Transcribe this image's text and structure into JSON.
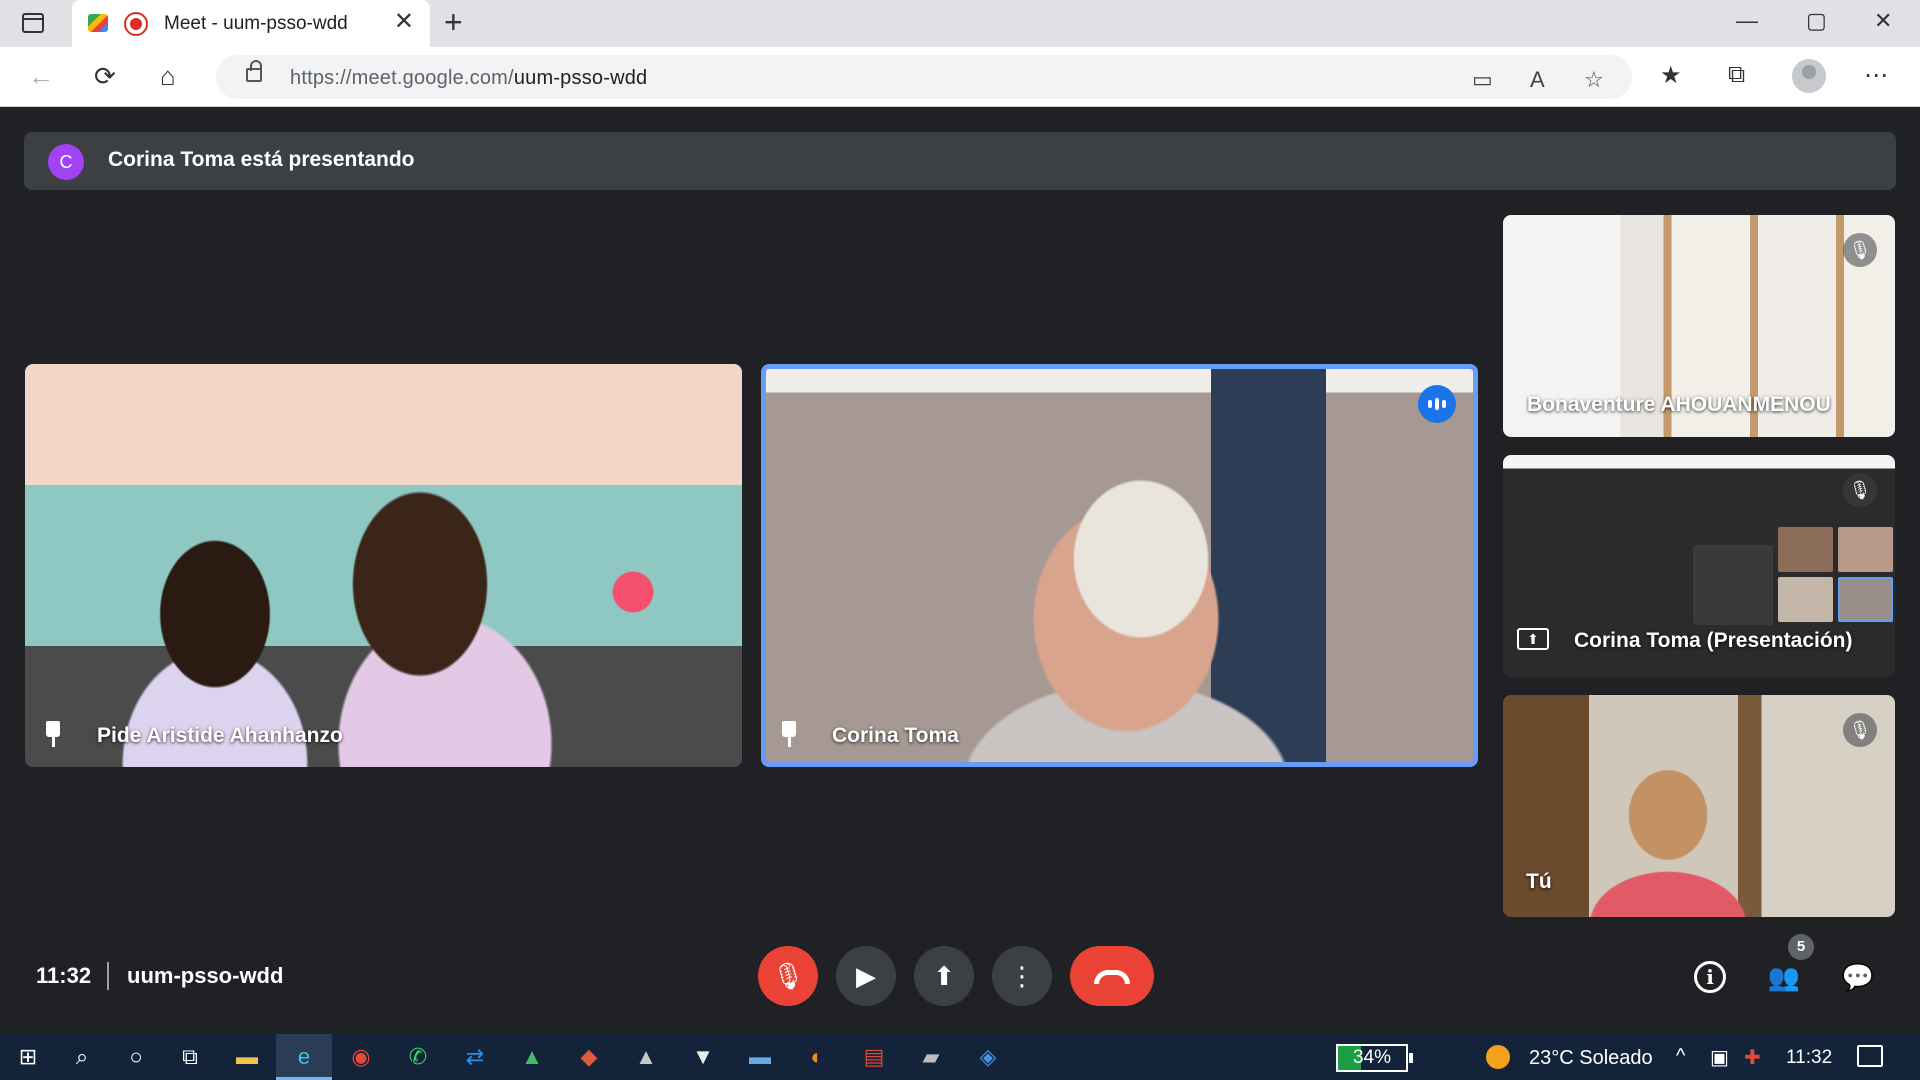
{
  "browser": {
    "tab_title": "Meet - uum-psso-wdd",
    "url_host": "https://meet.google.com/",
    "url_path": "uum-psso-wdd",
    "icons": {
      "new_tab": "+",
      "minimize": "—",
      "maximize": "▢",
      "close": "✕",
      "tab_close": "✕",
      "back": "←",
      "reload": "⟳",
      "home": "⌂",
      "camera": "▭",
      "read_aloud": "A",
      "add_favorite": "☆",
      "favorites": "★",
      "collections": "⧉",
      "more": "⋯"
    }
  },
  "banner": {
    "avatar_letter": "C",
    "avatar_color": "#a142f4",
    "text": "Corina Toma está presentando"
  },
  "tiles": {
    "pide": {
      "name": "Pide Aristide Ahanhanzo"
    },
    "corina": {
      "name": "Corina Toma"
    },
    "bona": {
      "name": "Bonaventure AHOUANMENOU"
    },
    "presentation": {
      "name": "Corina Toma (Presentación)"
    },
    "you": {
      "name": "Tú"
    }
  },
  "mic_off_icon": "🎙",
  "present_icon": "⬆",
  "meeting": {
    "time": "11:32",
    "code": "uum-psso-wdd"
  },
  "controls": {
    "mic": "🎙",
    "camera": "▶",
    "present": "⬆",
    "more": "⋮"
  },
  "right_panel": {
    "info": "i",
    "people": "👥",
    "people_count": "5",
    "chat": "💬"
  },
  "taskbar": {
    "apps": {
      "start": "⊞",
      "search": "⌕",
      "cortana": "○",
      "task_view": "⧉",
      "explorer": "▬",
      "edge": "e",
      "chrome": "◉",
      "whatsapp": "✆",
      "teamviewer": "⇄",
      "drive": "▲",
      "app9": "◆",
      "app10": "▲",
      "app11": "▼",
      "app12": "▬",
      "firefox": "◐",
      "pdf": "▤",
      "app15": "▰",
      "app16": "◈"
    },
    "battery": "34%",
    "weather": "23°C  Soleado",
    "clock": "11:32",
    "tray_chevron": "^",
    "tray_meet": "▣",
    "tray_badge_icon": "✚",
    "colors": {
      "accent": "#1a73e8",
      "end_call": "#ea4335",
      "speaking_border": "#669df6"
    }
  }
}
